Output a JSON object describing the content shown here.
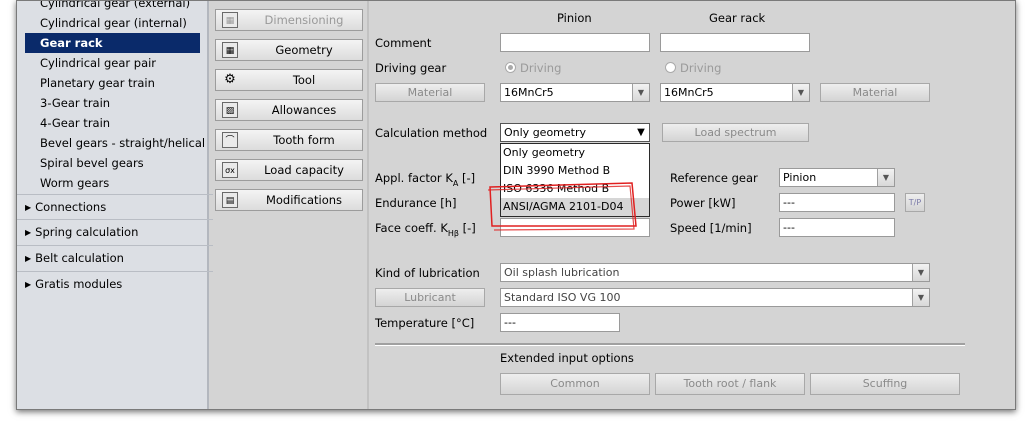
{
  "sidebar": {
    "subitems": [
      {
        "label": "Cylindrical gear (external)",
        "selected": false
      },
      {
        "label": "Cylindrical gear (internal)",
        "selected": false
      },
      {
        "label": "Gear rack",
        "selected": true
      },
      {
        "label": "Cylindrical gear pair",
        "selected": false
      },
      {
        "label": "Planetary gear train",
        "selected": false
      },
      {
        "label": "3-Gear train",
        "selected": false
      },
      {
        "label": "4-Gear train",
        "selected": false
      },
      {
        "label": "Bevel gears - straight/helical",
        "selected": false
      },
      {
        "label": "Spiral bevel gears",
        "selected": false
      },
      {
        "label": "Worm gears",
        "selected": false
      }
    ],
    "groups": [
      {
        "label": "Connections"
      },
      {
        "label": "Spring calculation"
      },
      {
        "label": "Belt calculation"
      },
      {
        "label": "Gratis modules"
      }
    ]
  },
  "toolbar": {
    "buttons": [
      {
        "label": "Dimensioning",
        "icon": "dimensioning-icon",
        "enabled": false
      },
      {
        "label": "Geometry",
        "icon": "grid-icon",
        "enabled": true
      },
      {
        "label": "Tool",
        "icon": "gear-tool-icon",
        "enabled": true
      },
      {
        "label": "Allowances",
        "icon": "allowances-icon",
        "enabled": true
      },
      {
        "label": "Tooth form",
        "icon": "tooth-form-icon",
        "enabled": true
      },
      {
        "label": "Load capacity",
        "icon": "load-capacity-icon",
        "enabled": true
      },
      {
        "label": "Modifications",
        "icon": "modifications-icon",
        "enabled": true
      }
    ]
  },
  "form": {
    "col_pinion": "Pinion",
    "col_rack": "Gear rack",
    "comment_label": "Comment",
    "comment_pinion": "",
    "comment_rack": "",
    "driving_label": "Driving gear",
    "driving_pinion": "Driving",
    "driving_rack": "Driving",
    "material_button": "Material",
    "material_pinion": "16MnCr5",
    "material_rack": "16MnCr5",
    "material_button_right": "Material",
    "calc_method_label": "Calculation method",
    "calc_method_value": "Only geometry",
    "calc_method_options": [
      "Only geometry",
      "DIN 3990 Method B",
      "ISO 6336 Method B",
      "ANSI/AGMA 2101-D04"
    ],
    "load_spectrum_button": "Load spectrum",
    "appl_factor_label_pre": "Appl. factor K",
    "appl_factor_sub": "A",
    "appl_factor_unit": "[-]",
    "endurance_label": "Endurance [h]",
    "face_coeff_label_pre": "Face coeff. K",
    "face_coeff_sub": "Hβ",
    "face_coeff_unit": "[-]",
    "reference_gear_label": "Reference gear",
    "reference_gear_value": "Pinion",
    "power_label": "Power [kW]",
    "power_value": "---",
    "tp_button": "T/P",
    "speed_label": "Speed [1/min]",
    "speed_value": "---",
    "lubrication_label": "Kind of lubrication",
    "lubrication_value": "Oil splash lubrication",
    "lubricant_button": "Lubricant",
    "lubricant_value": "Standard ISO VG 100",
    "temperature_label": "Temperature [°C]",
    "temperature_value": "---",
    "extended_label": "Extended input options",
    "common_button": "Common",
    "toothroot_button": "Tooth root / flank",
    "scuffing_button": "Scuffing"
  },
  "colors": {
    "selected_bg": "#0a2a6a",
    "highlight_annotation": "#e02020"
  }
}
